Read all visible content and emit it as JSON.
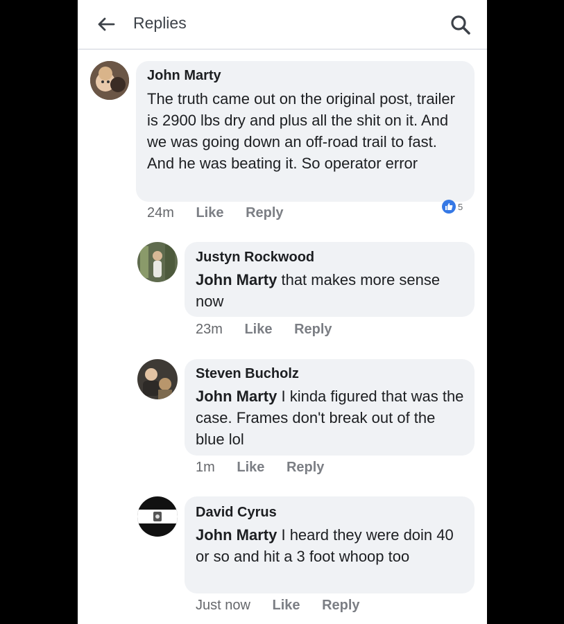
{
  "header": {
    "title": "Replies",
    "back_icon": "back-arrow-icon",
    "search_icon": "search-icon"
  },
  "comments": [
    {
      "author": "John Marty",
      "mention": "",
      "text": "The truth came out on the original post, trailer is 2900 lbs dry and plus all the shit on it. And we was going down an off-road trail to fast. And he was beating it. So operator error",
      "time": "24m",
      "like": "Like",
      "reply": "Reply",
      "reaction_count": "5"
    },
    {
      "author": "Justyn Rockwood",
      "mention": "John Marty",
      "text": " that makes more sense now",
      "time": "23m",
      "like": "Like",
      "reply": "Reply"
    },
    {
      "author": "Steven Bucholz",
      "mention": "John Marty",
      "text": " I kinda figured that was the case. Frames don't break out of the blue lol",
      "time": "1m",
      "like": "Like",
      "reply": "Reply"
    },
    {
      "author": "David Cyrus",
      "mention": "John Marty",
      "text": " I heard they were doin 40 or so and hit a 3 foot whoop too",
      "time": "Just now",
      "like": "Like",
      "reply": "Reply"
    }
  ],
  "colors": {
    "bubble": "#f0f2f5",
    "accent": "#3578e5",
    "meta": "#65676b"
  }
}
